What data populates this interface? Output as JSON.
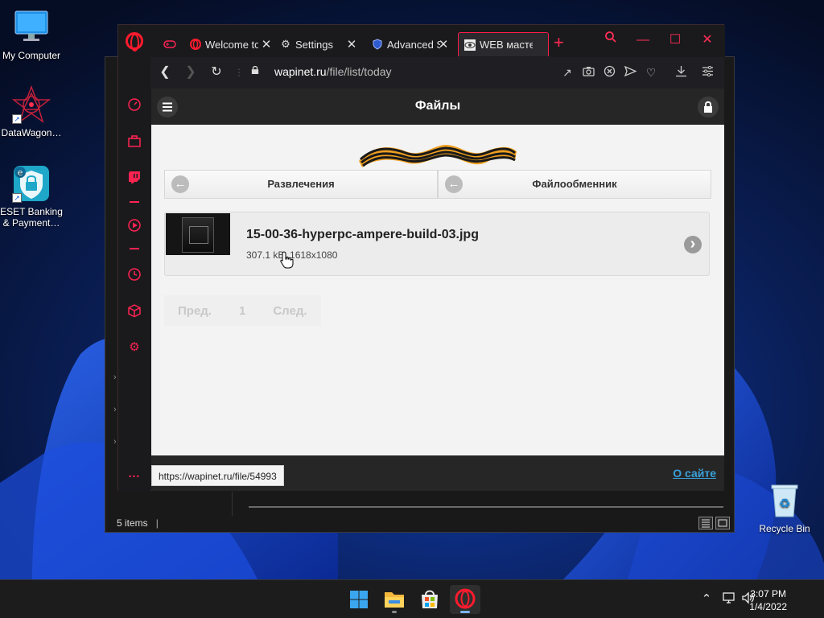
{
  "desktop": {
    "icons": [
      {
        "label": "My Computer"
      },
      {
        "label": "DataWagon…"
      },
      {
        "label": "ESET Banking & Payment…"
      },
      {
        "label": "Recycle Bin"
      }
    ]
  },
  "explorer": {
    "status_text": "5 items"
  },
  "browser": {
    "tabs": [
      {
        "label": "Welcome to",
        "icon": "opera-icon"
      },
      {
        "label": "Settings",
        "icon": "gear-icon"
      },
      {
        "label": "Advanced S",
        "icon": "shield-icon"
      },
      {
        "label": "WEB масте",
        "icon": "eye-icon",
        "active": true
      }
    ],
    "address": {
      "host": "wapinet.ru",
      "path": "/file/list/today"
    },
    "status_url": "https://wapinet.ru/file/54993"
  },
  "site": {
    "header_title": "Файлы",
    "nav": {
      "left_label": "Развлечения",
      "right_label": "Файлообменник"
    },
    "file": {
      "name": "15-00-36-hyperpc-ampere-build-03.jpg",
      "meta": "307.1 kB, 1618x1080"
    },
    "pager": {
      "prev": "Пред.",
      "current": "1",
      "next": "След."
    },
    "footer_link": "О сайте"
  },
  "taskbar": {
    "time": "3:07 PM",
    "date": "1/4/2022"
  },
  "colors": {
    "opera_accent": "#ff1b2d",
    "link": "#3aa0d9"
  }
}
